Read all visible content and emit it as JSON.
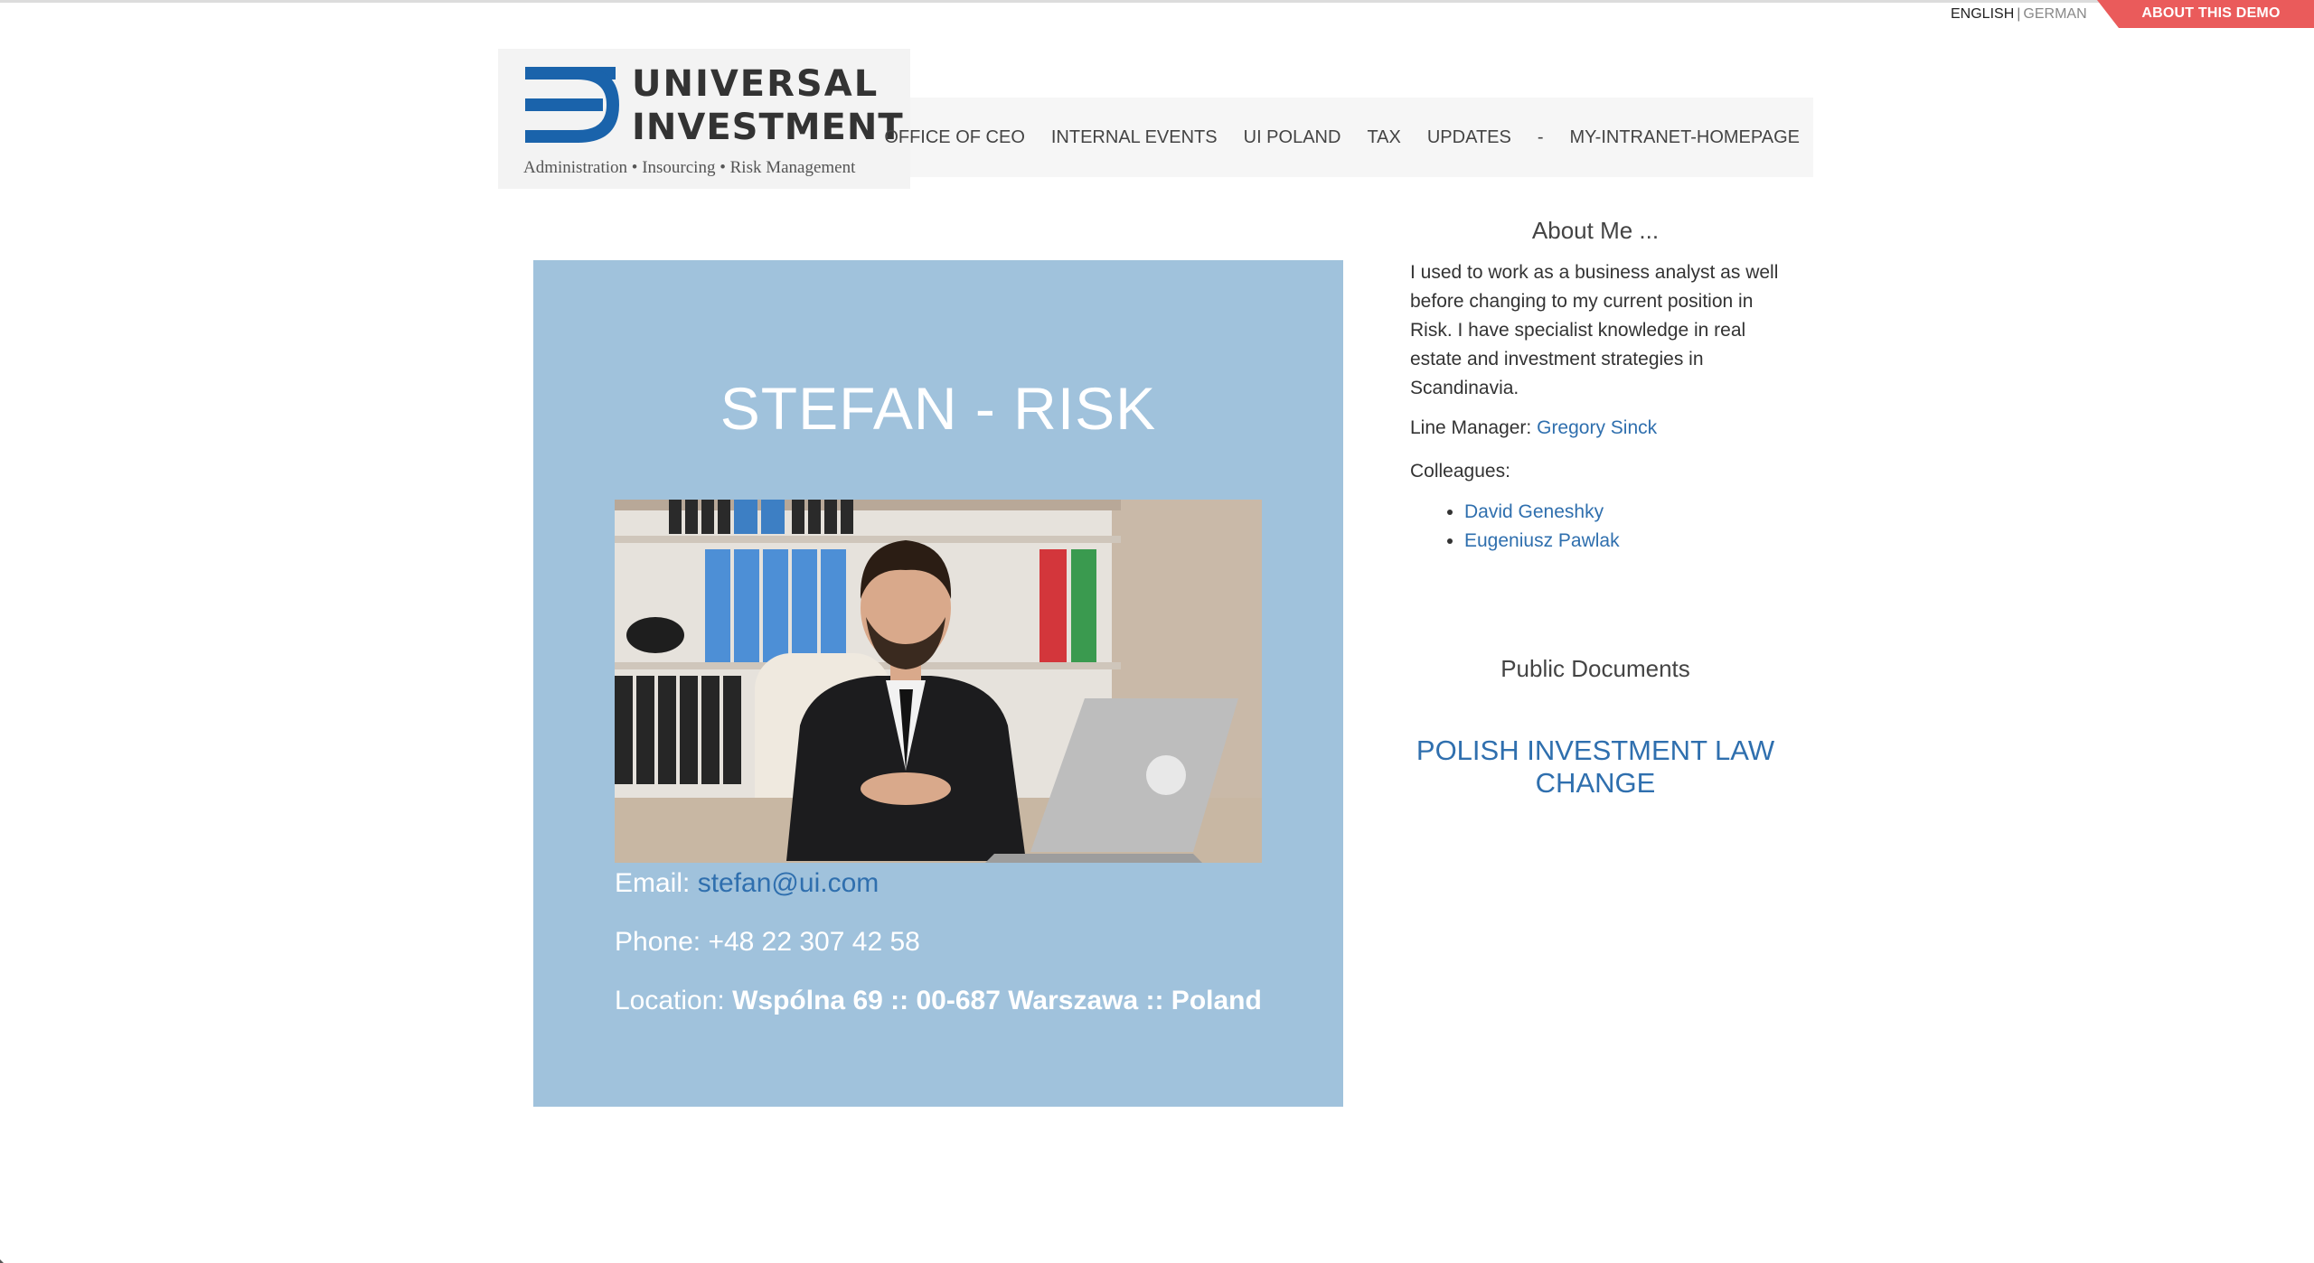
{
  "lang": {
    "active": "ENGLISH",
    "separator": "|",
    "other": "GERMAN"
  },
  "demo_ribbon": "ABOUT THIS DEMO",
  "logo": {
    "line1": "UNIVERSAL",
    "line2": "INVESTMENT",
    "tagline": "Administration • Insourcing • Risk Management",
    "brand_color": "#1a63ab"
  },
  "nav": {
    "items": [
      {
        "label": "OFFICE OF CEO"
      },
      {
        "label": "INTERNAL EVENTS"
      },
      {
        "label": "UI POLAND"
      },
      {
        "label": "TAX"
      },
      {
        "label": "UPDATES"
      },
      {
        "label": "-"
      },
      {
        "label": "MY-INTRANET-HOMEPAGE"
      }
    ]
  },
  "profile": {
    "title": "STEFAN - RISK",
    "email_label": "Email:",
    "email": "stefan@ui.com",
    "phone_label": "Phone:",
    "phone": "+48 22 307 42 58",
    "location_label": "Location:",
    "location": "Wspólna 69 :: 00-687 Warszawa :: Poland",
    "card_color": "#a0c2dc"
  },
  "sidebar": {
    "about_heading": "About Me ...",
    "about_text": "I used to work as a business analyst as well before changing to my current position in Risk. I have specialist knowledge in real estate and investment strategies in Scandinavia.",
    "line_manager_label": "Line Manager:",
    "line_manager": "Gregory Sinck",
    "colleagues_label": "Colleagues:",
    "colleagues": [
      "David Geneshky",
      "Eugeniusz Pawlak"
    ],
    "docs_heading": "Public Documents",
    "doc_link": "POLISH INVESTMENT LAW CHANGE",
    "link_color": "#2f6fae"
  }
}
